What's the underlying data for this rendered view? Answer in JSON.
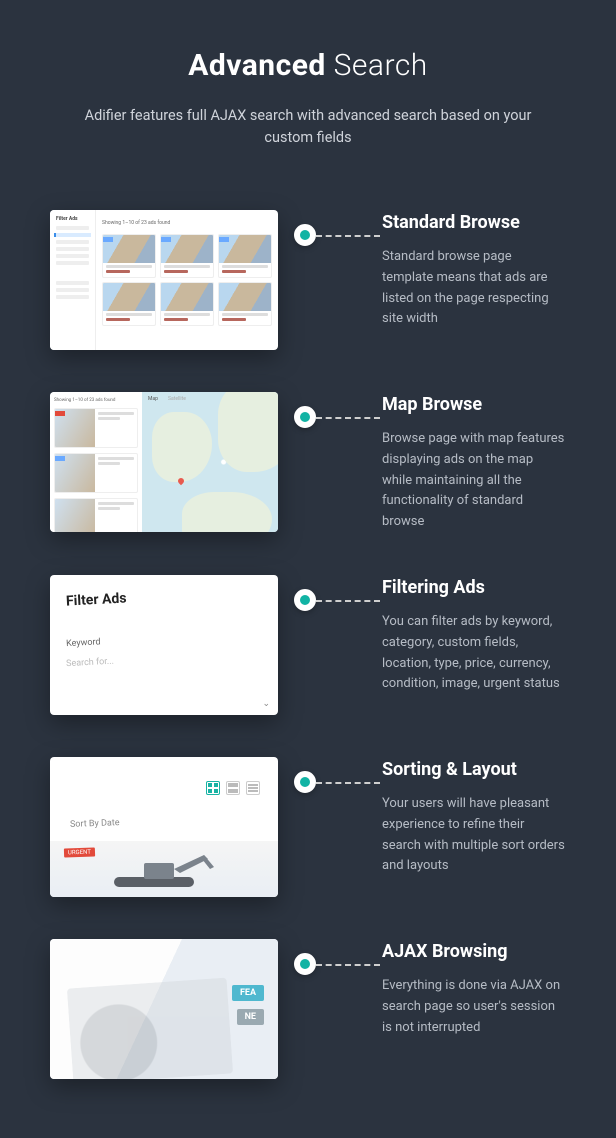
{
  "heading": {
    "strong": "Advanced",
    "rest": " Search"
  },
  "intro": "Adifier features full AJAX search with advanced search based on your custom fields",
  "features": [
    {
      "title": "Standard Browse",
      "desc": "Standard browse page template means that ads are listed on the page respecting site width"
    },
    {
      "title": "Map Browse",
      "desc": "Browse page with map features displaying ads on the map while maintaining all the functionality of standard browse"
    },
    {
      "title": "Filtering Ads",
      "desc": "You can filter ads by keyword, category, custom fields, location, type, price, currency, condition, image, urgent status"
    },
    {
      "title": "Sorting & Layout",
      "desc": "Your users will have pleasant experience to refine their search with multiple sort orders and layouts"
    },
    {
      "title": "AJAX Browsing",
      "desc": "Everything is done via AJAX on search page so user's session is not interrupted"
    }
  ],
  "shot1": {
    "sidebar_title": "Filter Ads",
    "results_text": "Showing 1–10 of 23 ads found"
  },
  "shot2": {
    "results_text": "Showing 1–10 of 23 ads found",
    "map_tabs": {
      "map": "Map",
      "sat": "Satellite"
    }
  },
  "shot3": {
    "title": "Filter Ads",
    "label": "Keyword",
    "placeholder": "Search for..."
  },
  "shot4": {
    "sort_label": "Sort By Date",
    "urgent": "URGENT"
  },
  "shot5": {
    "badge_feat": "FEA",
    "badge_ne": "NE"
  }
}
